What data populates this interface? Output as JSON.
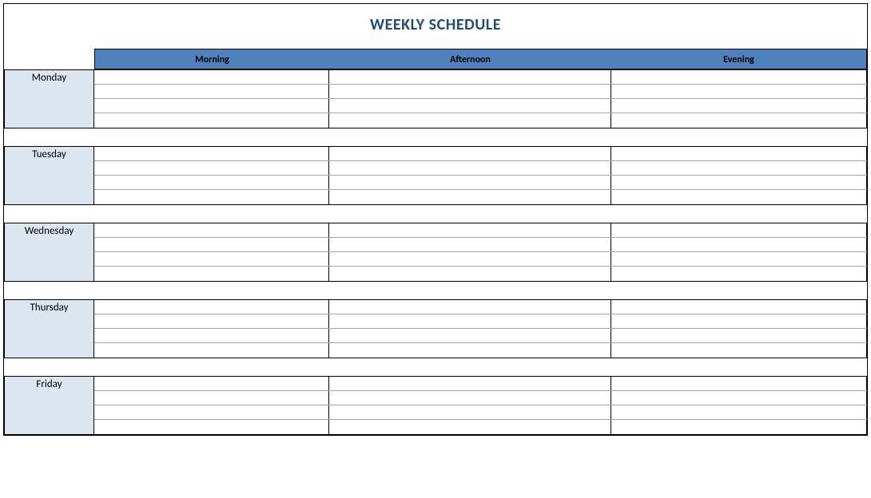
{
  "title": "WEEKLY SCHEDULE",
  "columns": {
    "morning": "Morning",
    "afternoon": "Afternoon",
    "evening": "Evening"
  },
  "days": {
    "monday": "Monday",
    "tuesday": "Tuesday",
    "wednesday": "Wednesday",
    "thursday": "Thursday",
    "friday": "Friday"
  },
  "colors": {
    "title": "#1f4e79",
    "header_bg": "#4f81bd",
    "day_bg": "#dce6f1"
  }
}
